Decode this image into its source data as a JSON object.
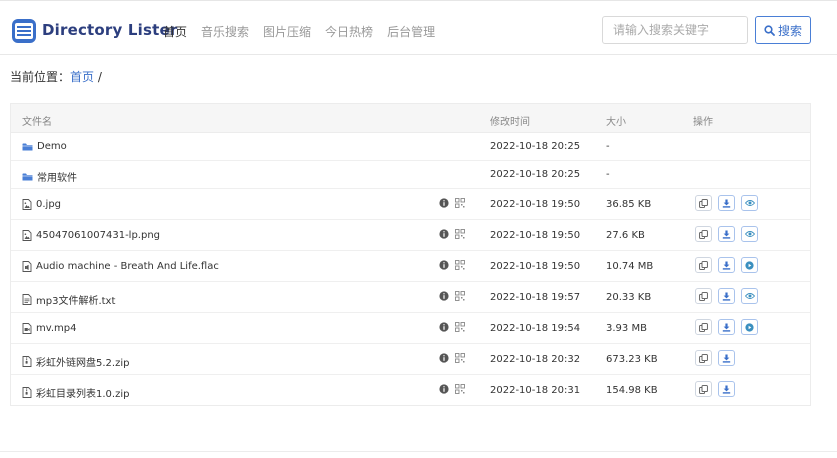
{
  "header": {
    "brand": "Directory Lister",
    "nav": [
      {
        "label": "首页",
        "active": true
      },
      {
        "label": "音乐搜索",
        "active": false
      },
      {
        "label": "图片压缩",
        "active": false
      },
      {
        "label": "今日热榜",
        "active": false
      },
      {
        "label": "后台管理",
        "active": false
      }
    ],
    "search_placeholder": "请输入搜索关键字",
    "search_button": "搜索"
  },
  "breadcrumb": {
    "prefix": "当前位置：",
    "home": "首页",
    "separator": "/"
  },
  "table": {
    "columns": {
      "name": "文件名",
      "modified": "修改时间",
      "size": "大小",
      "actions": "操作"
    },
    "rows": [
      {
        "name": "Demo",
        "type": "folder",
        "date": "2022-10-18 20:25",
        "size": "-",
        "icon": "folder-icon"
      },
      {
        "name": "常用软件",
        "type": "folder",
        "date": "2022-10-18 20:25",
        "size": "-",
        "icon": "folder-icon"
      },
      {
        "name": "0.jpg",
        "type": "image",
        "date": "2022-10-18 19:50",
        "size": "36.85 KB",
        "icon": "image-file-icon",
        "preview": "view"
      },
      {
        "name": "45047061007431-lp.png",
        "type": "image",
        "date": "2022-10-18 19:50",
        "size": "27.6 KB",
        "icon": "image-file-icon",
        "preview": "view"
      },
      {
        "name": "Audio machine - Breath And Life.flac",
        "type": "audio",
        "date": "2022-10-18 19:50",
        "size": "10.74 MB",
        "icon": "audio-file-icon",
        "preview": "play"
      },
      {
        "name": "mp3文件解析.txt",
        "type": "text",
        "date": "2022-10-18 19:57",
        "size": "20.33 KB",
        "icon": "text-file-icon",
        "preview": "view"
      },
      {
        "name": "mv.mp4",
        "type": "video",
        "date": "2022-10-18 19:54",
        "size": "3.93 MB",
        "icon": "video-file-icon",
        "preview": "play"
      },
      {
        "name": "彩虹外链网盘5.2.zip",
        "type": "archive",
        "date": "2022-10-18 20:32",
        "size": "673.23 KB",
        "icon": "archive-file-icon",
        "preview": ""
      },
      {
        "name": "彩虹目录列表1.0.zip",
        "type": "archive",
        "date": "2022-10-18 20:31",
        "size": "154.98 KB",
        "icon": "archive-file-icon",
        "preview": ""
      }
    ]
  },
  "colors": {
    "accent": "#3a6fc9",
    "folder": "#4a7fd6",
    "brand": "#2c3e7e"
  }
}
